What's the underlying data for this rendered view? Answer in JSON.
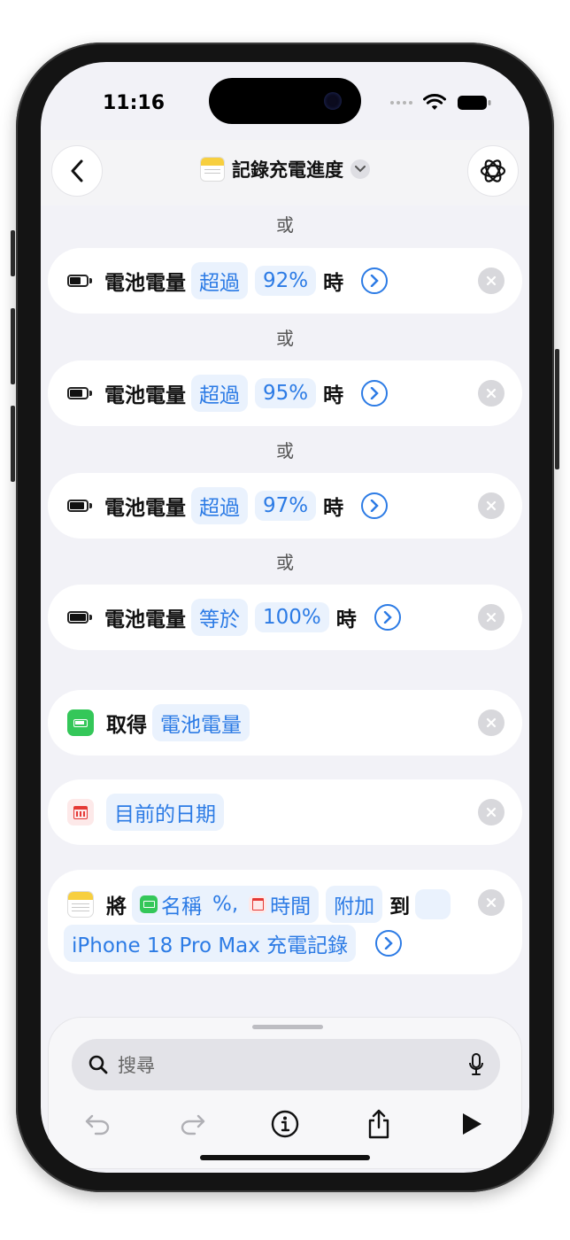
{
  "status_bar": {
    "time": "11:16"
  },
  "nav": {
    "title": "記錄充電進度"
  },
  "conditions": {
    "separator": "或",
    "rows": [
      {
        "subject": "電池電量",
        "operator": "超過",
        "value": "92%",
        "suffix": "時"
      },
      {
        "subject": "電池電量",
        "operator": "超過",
        "value": "95%",
        "suffix": "時"
      },
      {
        "subject": "電池電量",
        "operator": "超過",
        "value": "97%",
        "suffix": "時"
      },
      {
        "subject": "電池電量",
        "operator": "等於",
        "value": "100%",
        "suffix": "時"
      }
    ]
  },
  "actions": {
    "get_battery": {
      "verb": "取得",
      "param": "電池電量"
    },
    "current_date": {
      "param": "目前的日期"
    },
    "append_note": {
      "verb": "將",
      "name_var": "名稱",
      "percent": "%,",
      "time_var": "時間",
      "append": "附加",
      "to": "到",
      "target": "iPhone 18 Pro Max 充電記錄"
    }
  },
  "bottom_bar": {
    "search_placeholder": "搜尋",
    "icons": [
      "undo-icon",
      "redo-icon",
      "info-icon",
      "share-icon",
      "play-icon"
    ]
  },
  "colors": {
    "accent": "#2c7be5",
    "green": "#34c759",
    "background": "#f2f2f7"
  }
}
